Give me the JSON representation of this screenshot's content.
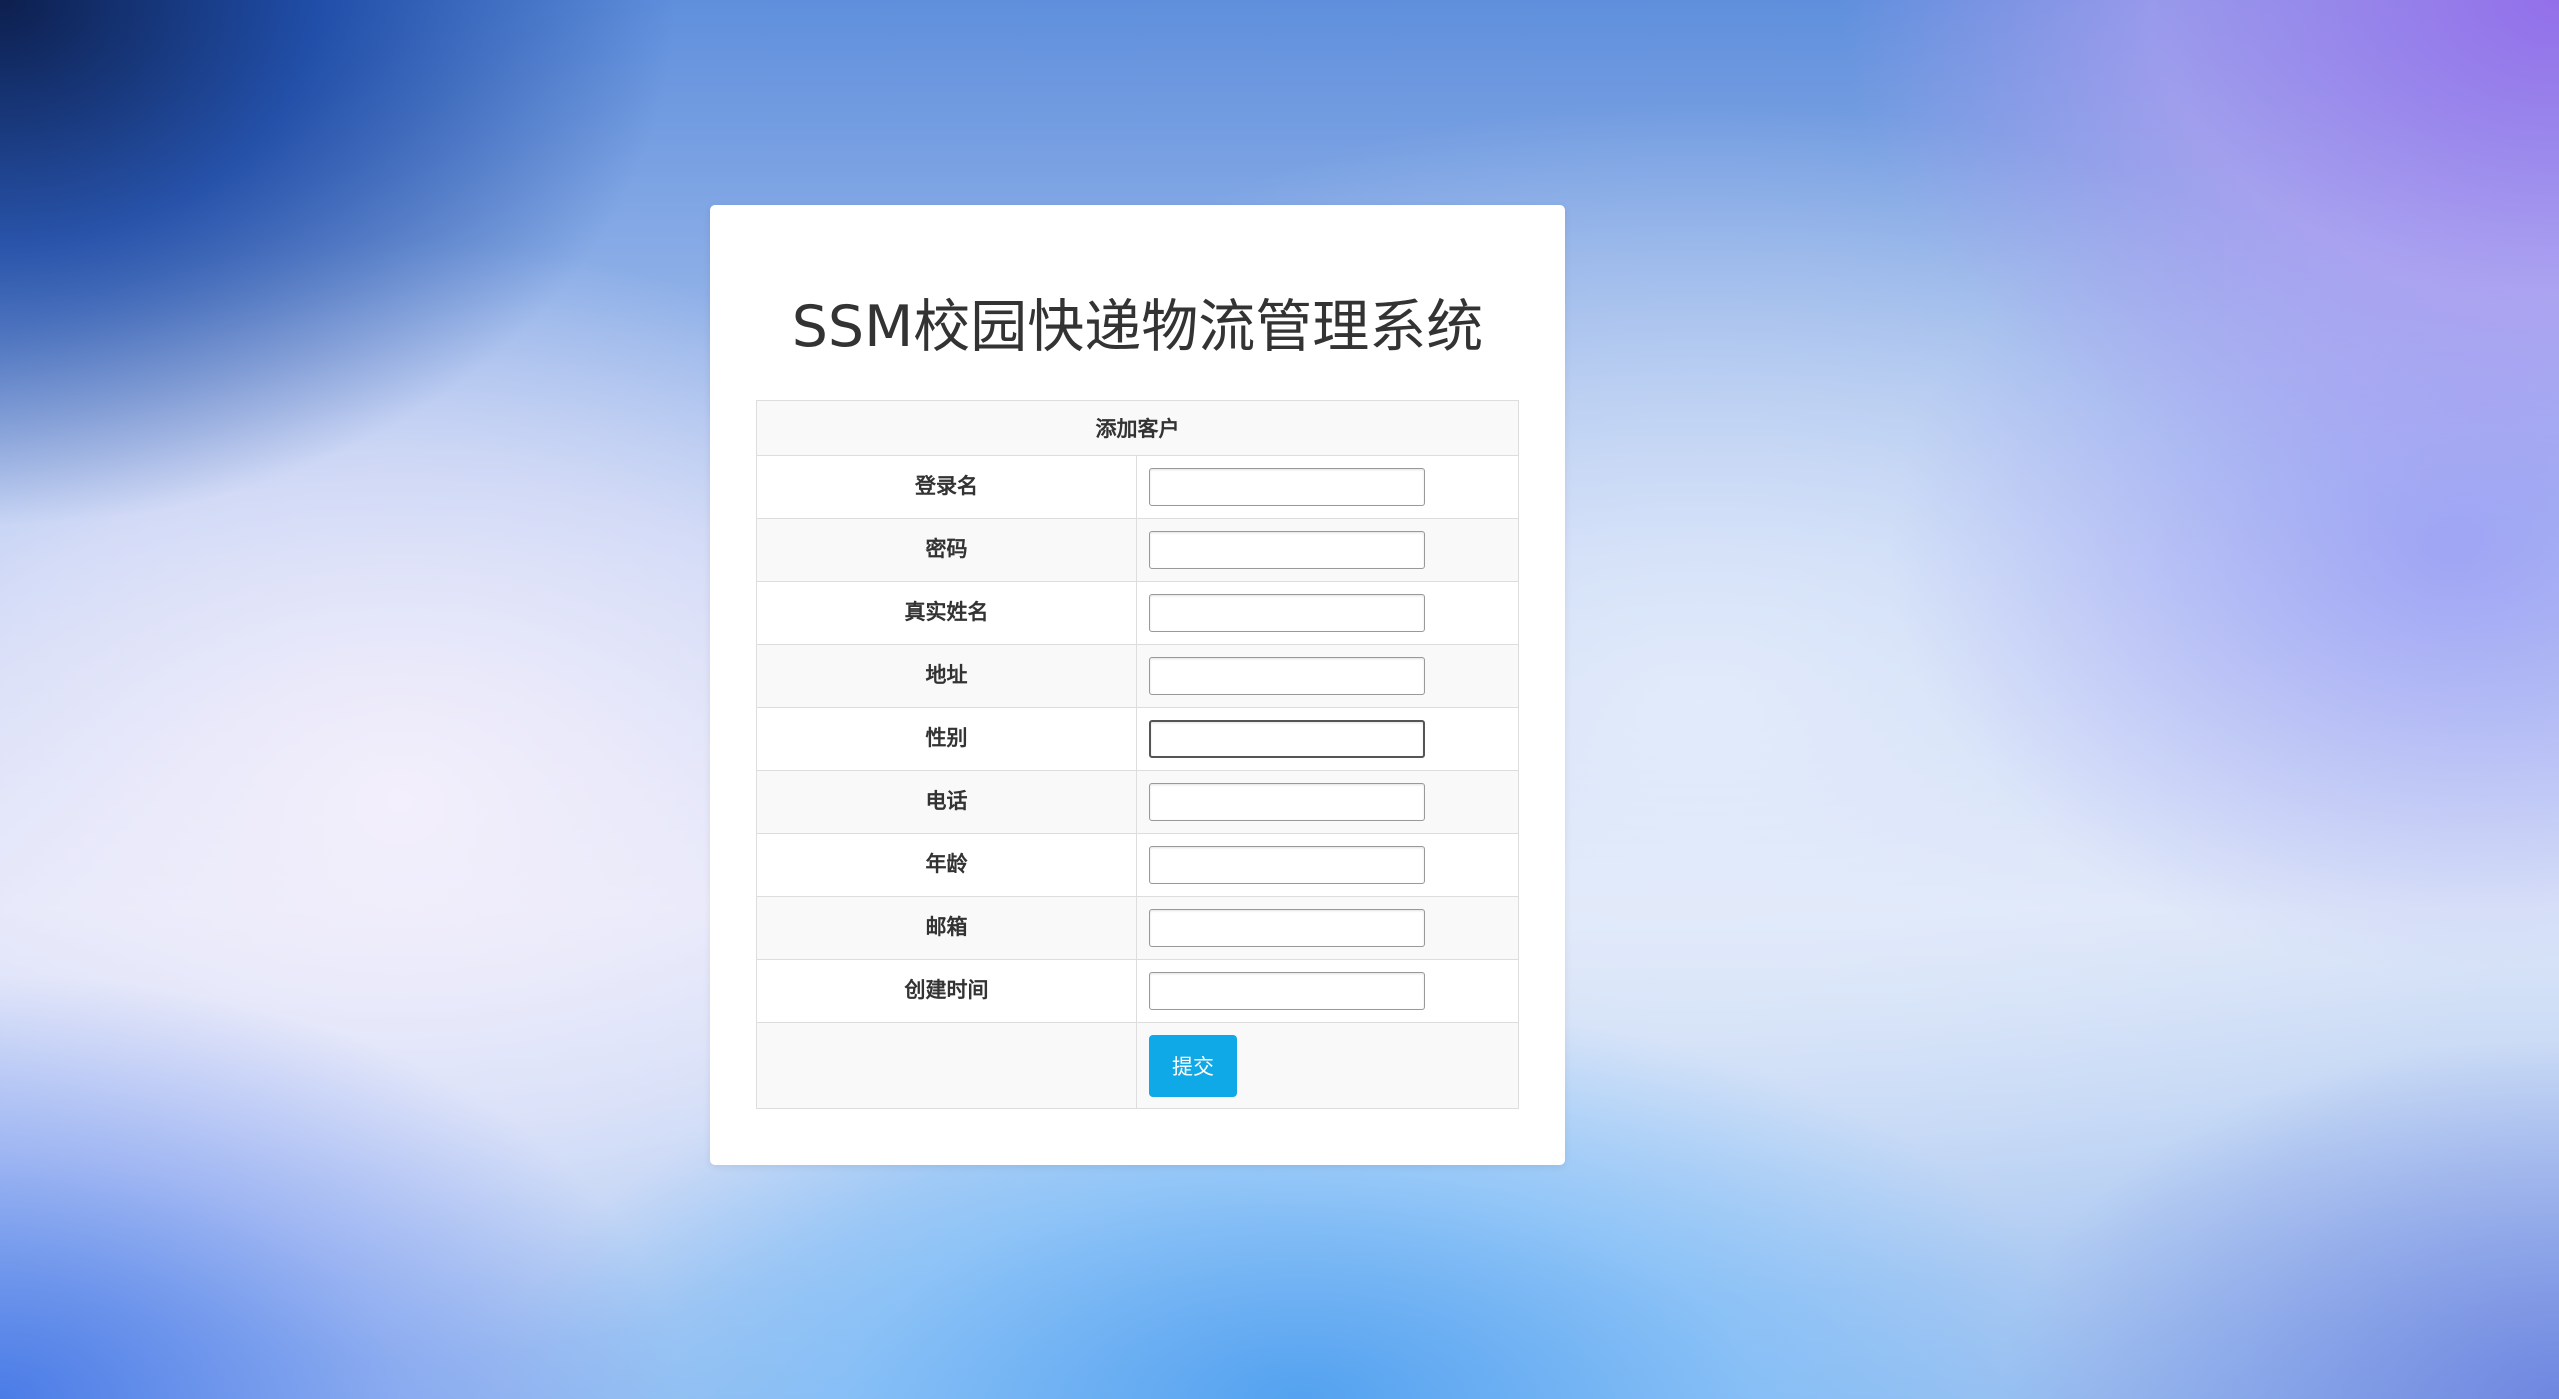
{
  "app": {
    "title": "SSM校园快递物流管理系统"
  },
  "form": {
    "heading": "添加客户",
    "fields": [
      {
        "label": "登录名",
        "value": "",
        "placeholder": ""
      },
      {
        "label": "密码",
        "value": "",
        "placeholder": ""
      },
      {
        "label": "真实姓名",
        "value": "",
        "placeholder": ""
      },
      {
        "label": "地址",
        "value": "",
        "placeholder": ""
      },
      {
        "label": "性别",
        "value": "",
        "placeholder": ""
      },
      {
        "label": "电话",
        "value": "",
        "placeholder": ""
      },
      {
        "label": "年龄",
        "value": "",
        "placeholder": ""
      },
      {
        "label": "邮箱",
        "value": "",
        "placeholder": ""
      },
      {
        "label": "创建时间",
        "value": "",
        "placeholder": ""
      }
    ],
    "submit_label": "提交"
  },
  "colors": {
    "accent": "#10a9e8",
    "card_background": "#ffffff",
    "row_stripe": "#f9f9f9",
    "border": "#dddddd",
    "text": "#333333"
  }
}
